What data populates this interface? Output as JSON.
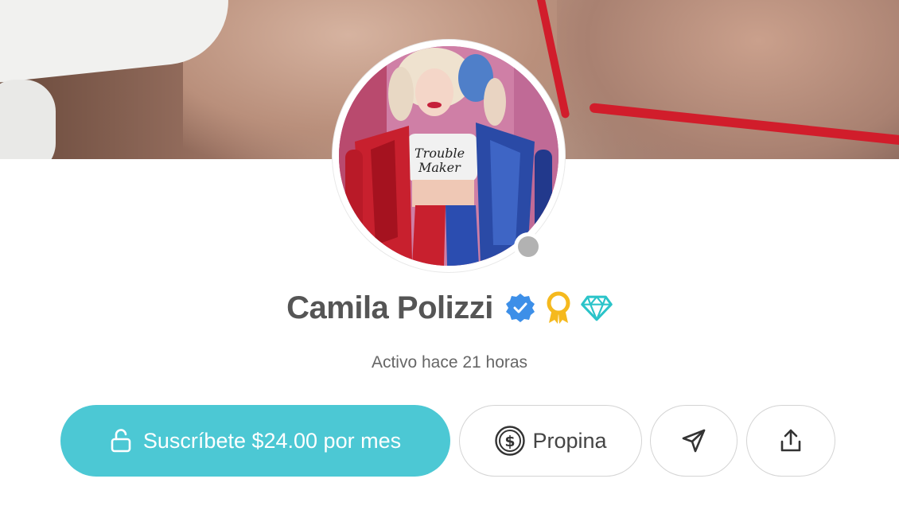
{
  "profile": {
    "name": "Camila Polizzi",
    "status": "Activo hace 21 horas",
    "badges": [
      "verified-check-icon",
      "award-ribbon-icon",
      "diamond-icon"
    ],
    "online_indicator": "offline-gray-dot"
  },
  "actions": {
    "subscribe_label": "Suscríbete $24.00 por mes",
    "tip_label": "Propina",
    "message_icon": "send-icon",
    "share_icon": "share-icon"
  },
  "colors": {
    "subscribe_bg": "#4cc8d4",
    "verified": "#3d8fe8",
    "award": "#f5b91e",
    "diamond": "#2bc4c9",
    "name_text": "#555555",
    "status_dot": "#b2b2b2"
  }
}
